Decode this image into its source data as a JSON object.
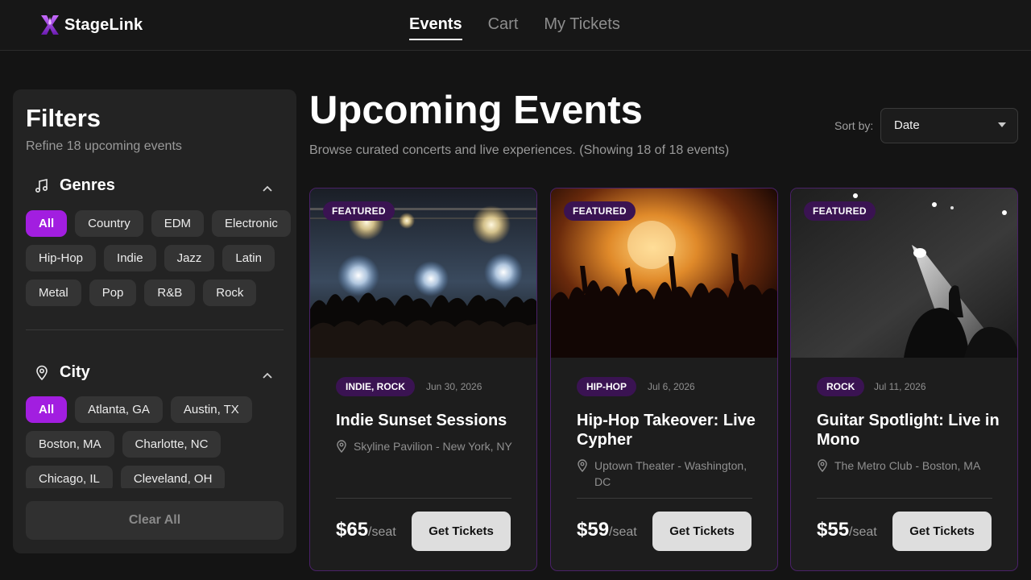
{
  "app": {
    "name": "StageLink"
  },
  "nav": {
    "items": [
      "Events",
      "Cart",
      "My Tickets"
    ],
    "active": "Events"
  },
  "sidebar": {
    "title": "Filters",
    "subtitle": "Refine 18 upcoming events",
    "genres": {
      "label": "Genres",
      "items": [
        "All",
        "Country",
        "EDM",
        "Electronic",
        "Hip-Hop",
        "Indie",
        "Jazz",
        "Latin",
        "Metal",
        "Pop",
        "R&B",
        "Rock"
      ],
      "selected": "All"
    },
    "city": {
      "label": "City",
      "items": [
        "All",
        "Atlanta, GA",
        "Austin, TX",
        "Boston, MA",
        "Charlotte, NC",
        "Chicago, IL",
        "Cleveland, OH"
      ],
      "selected": "All"
    },
    "clear_label": "Clear All"
  },
  "main": {
    "title": "Upcoming Events",
    "subtitle": "Browse curated concerts and live experiences. (Showing 18 of 18 events)",
    "sort": {
      "label": "Sort by:",
      "value": "Date"
    }
  },
  "events": [
    {
      "badge": "FEATURED",
      "genres": "INDIE, ROCK",
      "date": "Jun 30, 2026",
      "title": "Indie Sunset Sessions",
      "venue": "Skyline Pavilion - New York, NY",
      "price": "$65",
      "price_unit": "/seat",
      "button": "Get Tickets"
    },
    {
      "badge": "FEATURED",
      "genres": "HIP-HOP",
      "date": "Jul 6, 2026",
      "title": "Hip-Hop Takeover: Live Cypher",
      "venue": "Uptown Theater - Washington, DC",
      "price": "$59",
      "price_unit": "/seat",
      "button": "Get Tickets"
    },
    {
      "badge": "FEATURED",
      "genres": "ROCK",
      "date": "Jul 11, 2026",
      "title": "Guitar Spotlight: Live in Mono",
      "venue": "The Metro Club - Boston, MA",
      "price": "$55",
      "price_unit": "/seat",
      "button": "Get Tickets"
    }
  ],
  "colors": {
    "accent": "#a21ee0",
    "badge_bg": "#3a1352",
    "card_border": "#4a2168",
    "background": "#141414"
  }
}
